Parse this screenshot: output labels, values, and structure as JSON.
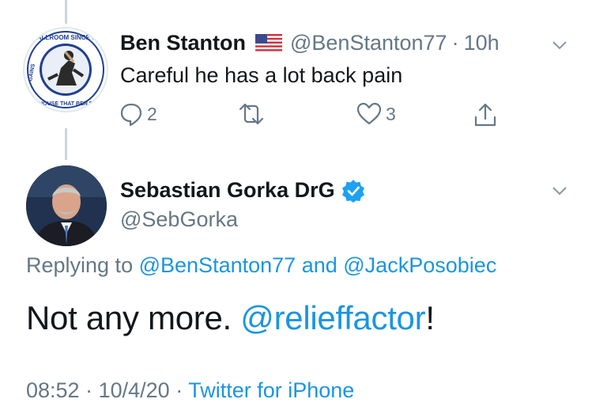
{
  "reply_tweet": {
    "author_name": "Ben Stanton",
    "author_flag": "us-flag-icon",
    "handle": "@BenStanton77",
    "separator": "·",
    "time": "10h",
    "text": "Careful he has a lot back pain",
    "avatar_ring_text_top": "BALLROOM SINCE 77",
    "avatar_ring_text_bottom": "THE HOUSE THAT BEN BUILT",
    "avatar_ring_text_left": "GAINS",
    "actions": {
      "reply_count": "2",
      "retweet_count": "",
      "like_count": "3"
    }
  },
  "main_tweet": {
    "author_name": "Sebastian Gorka DrG",
    "handle": "@SebGorka",
    "replying_prefix": "Replying to",
    "replying_to_1": "@BenStanton77",
    "replying_conjunction": "and",
    "replying_to_2": "@JackPosobiec",
    "text_before": "Not any more.",
    "mention": "@relieffactor",
    "text_after": "!",
    "time": "08:52",
    "separator": "·",
    "date": "10/4/20",
    "separator2": "·",
    "source": "Twitter for iPhone"
  },
  "colors": {
    "link": "#1b95e0",
    "muted": "#657786",
    "text": "#14171a",
    "thread_line": "#ccd6dd",
    "verified": "#1da1f2"
  }
}
